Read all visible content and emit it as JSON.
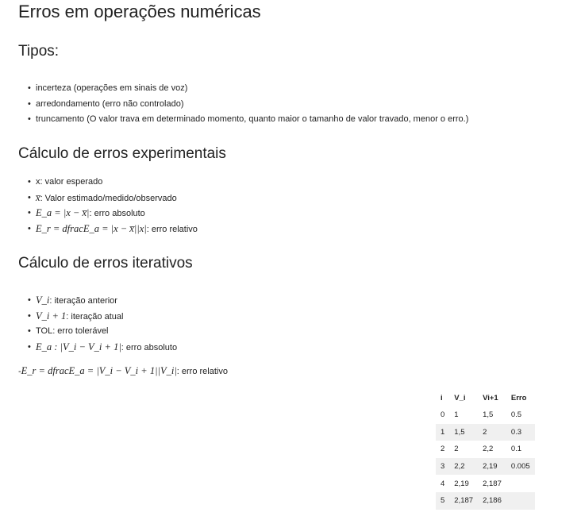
{
  "title": "Erros em operações numéricas",
  "tipos": {
    "heading": "Tipos:",
    "items": [
      "incerteza (operações em sinais de voz)",
      "arredondamento (erro não controlado)",
      "truncamento (O valor trava em determinado momento, quanto maior o tamanho de valor travado, menor o erro.)"
    ]
  },
  "experimentais": {
    "heading": "Cálculo de erros experimentais",
    "items": [
      {
        "math": "",
        "text": "x: valor esperado"
      },
      {
        "math": "x̅",
        "text": ": Valor estimado/medido/observado"
      },
      {
        "math": "E_a = |x − x̅|",
        "text": ": erro absoluto"
      },
      {
        "math": "E_r = dfracE_a = |x − x̅||x|",
        "text": ": erro relativo"
      }
    ]
  },
  "iterativos": {
    "heading": "Cálculo de erros iterativos",
    "items": [
      {
        "math": "V_i",
        "text": ": iteração anterior"
      },
      {
        "math": "V_i + 1",
        "text": ": iteração atual"
      },
      {
        "math": "",
        "text": "TOL: erro tolerável"
      },
      {
        "math": "E_a : |V_i − V_i + 1|",
        "text": ": erro absoluto"
      }
    ],
    "relativo": {
      "prefix": "-",
      "math": "E_r = dfracE_a = |V_i − V_i + 1||V_i|",
      "text": ": erro relativo"
    }
  },
  "table": {
    "headers": [
      "i",
      "V_i",
      "Vi+1",
      "Erro"
    ],
    "rows": [
      [
        "0",
        "1",
        "1,5",
        "0.5"
      ],
      [
        "1",
        "1,5",
        "2",
        "0.3"
      ],
      [
        "2",
        "2",
        "2,2",
        "0.1"
      ],
      [
        "3",
        "2,2",
        "2,19",
        "0.005"
      ],
      [
        "4",
        "2,19",
        "2,187",
        ""
      ],
      [
        "5",
        "2,187",
        "2,186",
        ""
      ]
    ]
  }
}
